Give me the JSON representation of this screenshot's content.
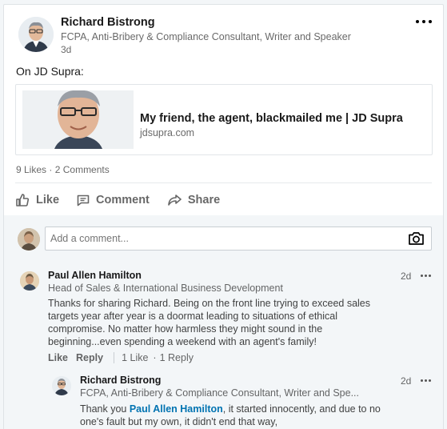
{
  "post": {
    "author_name": "Richard Bistrong",
    "author_headline": "FCPA, Anti-Bribery & Compliance Consultant, Writer and Speaker",
    "time": "3d",
    "text": "On JD Supra:",
    "more_icon": "more-horizontal-icon"
  },
  "link_card": {
    "title": "My friend, the agent, blackmailed me | JD Supra",
    "domain": "jdsupra.com"
  },
  "social": {
    "likes": "9 Likes",
    "separator": "·",
    "comments": "2 Comments"
  },
  "actions": [
    {
      "label": "Like",
      "icon": "thumbs-up-icon"
    },
    {
      "label": "Comment",
      "icon": "comment-icon"
    },
    {
      "label": "Share",
      "icon": "share-icon"
    }
  ],
  "comment_input": {
    "placeholder": "Add a comment...",
    "value": "",
    "icon": "camera-icon"
  },
  "comments": [
    {
      "name": "Paul Allen Hamilton",
      "headline": "Head of Sales & International Business Development",
      "time": "2d",
      "text": "Thanks for sharing Richard. Being on the front line trying to exceed sales targets year after year is a doormat leading to situations of ethical compromise. No matter how harmless they might sound in the beginning...even spending a weekend with an agent's family!",
      "like_label": "Like",
      "reply_label": "Reply",
      "like_count": "1 Like",
      "reply_count": "1 Reply",
      "dot": "·"
    },
    {
      "name": "Richard Bistrong",
      "headline": "FCPA, Anti-Bribery & Compliance Consultant, Writer and Spe...",
      "time": "2d",
      "text_before": "Thank you ",
      "mention": "Paul Allen Hamilton",
      "text_after": ", it started innocently, and due to no one's fault but my own, it didn't end that way,"
    }
  ],
  "colors": {
    "link_blue": "#0073b1",
    "comments_bg": "#f3f6f8"
  }
}
